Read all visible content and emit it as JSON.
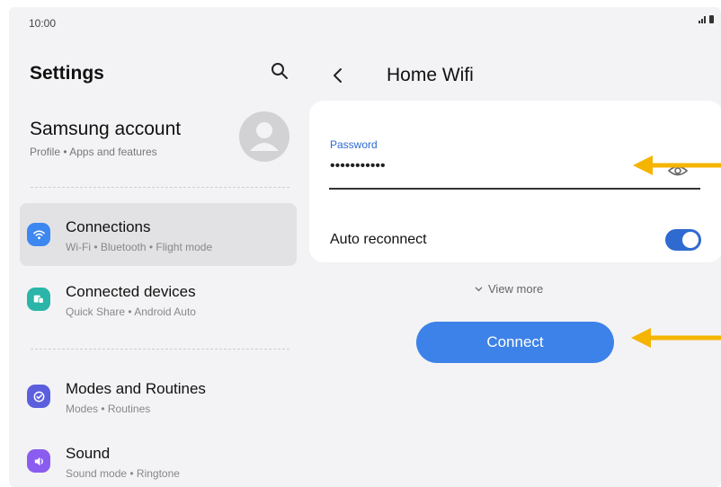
{
  "status_bar": {
    "time": "10:00"
  },
  "left_panel": {
    "title": "Settings",
    "account": {
      "name": "Samsung account",
      "subtitle": "Profile • Apps and features"
    },
    "items": [
      {
        "title": "Connections",
        "subtitle": "Wi-Fi • Bluetooth • Flight mode",
        "icon": "wifi-icon",
        "color": "#3d87f0",
        "active": true
      },
      {
        "title": "Connected devices",
        "subtitle": "Quick Share • Android Auto",
        "icon": "connected-devices-icon",
        "color": "#2ab5a8",
        "active": false
      },
      {
        "title": "Modes and Routines",
        "subtitle": "Modes • Routines",
        "icon": "check-circle-icon",
        "color": "#5b5fde",
        "active": false
      },
      {
        "title": "Sound",
        "subtitle": "Sound mode • Ringtone",
        "icon": "speaker-icon",
        "color": "#8a5cf0",
        "active": false
      }
    ]
  },
  "right_panel": {
    "title": "Home Wifi",
    "password": {
      "label": "Password",
      "value": "•••••••••••"
    },
    "auto_reconnect": {
      "label": "Auto reconnect",
      "enabled": true
    },
    "view_more": "View more",
    "connect_label": "Connect"
  },
  "colors": {
    "accent": "#2f6ad0",
    "button": "#3d82e8",
    "annotation_arrow": "#f5b400"
  }
}
